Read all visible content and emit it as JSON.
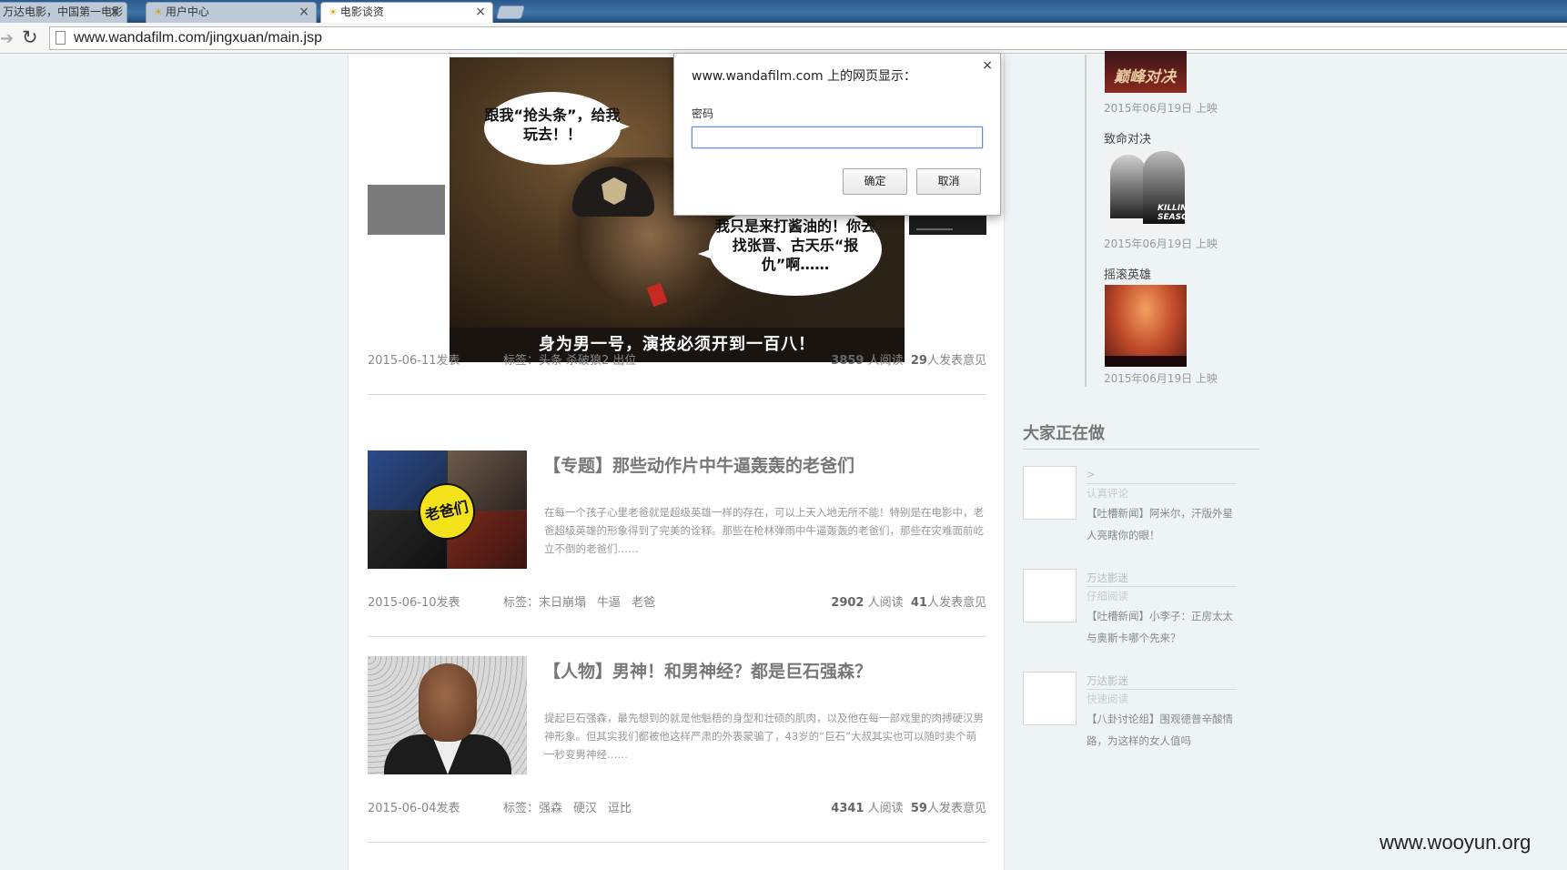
{
  "browser": {
    "tabs": [
      {
        "label": "万达电影，中国第一电影",
        "active": false
      },
      {
        "label": "用户中心",
        "active": false
      },
      {
        "label": "电影谈资",
        "active": true
      }
    ],
    "close_glyph": "×",
    "url": "www.wandafilm.com/jingxuan/main.jsp"
  },
  "hero": {
    "bubble1": "跟我“抢头条”，给我玩去！！",
    "bubble2": "我只是来打酱油的！你去找张晋、古天乐“报仇”啊……",
    "caption": "身为男一号，演技必须开到一百八！"
  },
  "articles": [
    {
      "date": "2015-06-11发表",
      "tags_label": "标签：",
      "tags": [
        "头条",
        "杀破狼2",
        "出位"
      ],
      "views": "3859",
      "views_suffix": "人阅读",
      "comments": "29",
      "comments_suffix": "人发表意见"
    },
    {
      "title": "【专题】那些动作片中牛逼轰轰的老爸们",
      "thumb_text": "老爸们",
      "desc": "在每一个孩子心里老爸就是超级英雄一样的存在，可以上天入地无所不能！特别是在电影中，老爸超级英雄的形象得到了完美的诠释。那些在枪林弹雨中牛逼轰轰的老爸们，那些在灾难面前屹立不倒的老爸们……",
      "date": "2015-06-10发表",
      "tags_label": "标签：",
      "tags": [
        "末日崩塌",
        "牛逼",
        "老爸"
      ],
      "views": "2902",
      "views_suffix": "人阅读",
      "comments": "41",
      "comments_suffix": "人发表意见"
    },
    {
      "title": "【人物】男神！和男神经？都是巨石强森？",
      "desc": "提起巨石强森，最先想到的就是他魁梧的身型和壮硕的肌肉，以及他在每一部戏里的肉搏硬汉男神形象。但其实我们都被他这样严肃的外表蒙骗了，43岁的“巨石”大叔其实也可以随时卖个萌一秒变男神经……",
      "date": "2015-06-04发表",
      "tags_label": "标签：",
      "tags": [
        "强森",
        "硬汉",
        "逗比"
      ],
      "views": "4341",
      "views_suffix": "人阅读",
      "comments": "59",
      "comments_suffix": "人发表意见"
    }
  ],
  "sidebar": {
    "movies": [
      {
        "poster_text": "巅峰对决",
        "name": "",
        "release": "2015年06月19日 上映"
      },
      {
        "poster_text": "KILLING SEASON",
        "name": "致命对决",
        "release": "2015年06月19日 上映"
      },
      {
        "poster_text": "",
        "name": "摇滚英雄",
        "release": "2015年06月19日 上映"
      }
    ],
    "activity_title": "大家正在做",
    "activities": [
      {
        "user": ">",
        "verb": "认真评论",
        "text": "【吐槽新闻】阿米尔，汗版外星人亮瞎你的眼！"
      },
      {
        "user": "万达影迷",
        "verb": "仔细阅读",
        "text": "【吐槽新闻】小李子：正房太太与奥斯卡哪个先来？"
      },
      {
        "user": "万达影迷",
        "verb": "快速阅读",
        "text": "【八卦讨论组】围观德普辛酸情路，为这样的女人值吗"
      }
    ]
  },
  "dialog": {
    "title": "www.wandafilm.com 上的网页显示：",
    "close": "×",
    "label": "密码",
    "value": "",
    "ok": "确定",
    "cancel": "取消"
  },
  "watermark": "www.wooyun.org"
}
